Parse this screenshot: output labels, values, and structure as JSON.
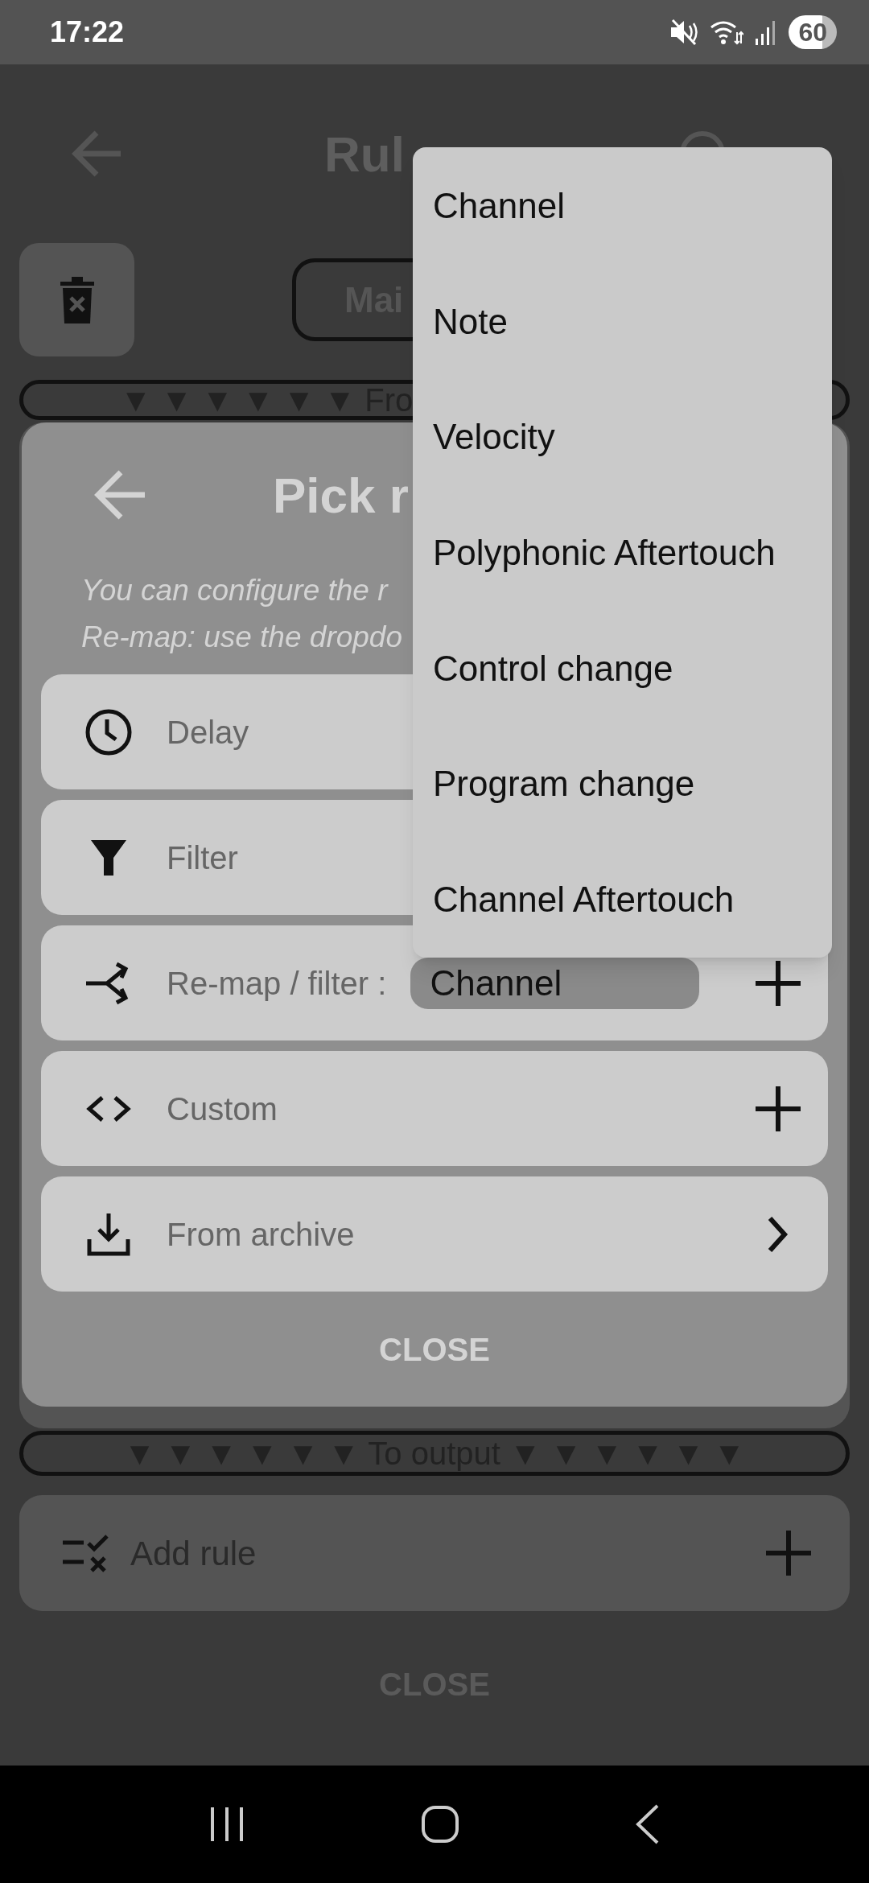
{
  "status_bar": {
    "time": "17:22",
    "battery": "60"
  },
  "page": {
    "title": "Rul",
    "tab_button": "Mai",
    "input_bar": "▼ ▼ ▼ ▼ ▼ ▼ Fro",
    "output_bar": "▼ ▼ ▼ ▼ ▼ ▼ To output ▼ ▼ ▼ ▼ ▼ ▼",
    "add_rule": "Add rule",
    "close": "CLOSE"
  },
  "dialog": {
    "title": "Pick r",
    "subtitle": [
      "You can configure the r",
      "Re-map: use the dropdo"
    ],
    "options": [
      {
        "kind": "delay",
        "label": "Delay"
      },
      {
        "kind": "filter",
        "label": "Filter"
      },
      {
        "kind": "remap",
        "label": "Re-map / filter :",
        "value": "Channel",
        "add": true
      },
      {
        "kind": "custom",
        "label": "Custom",
        "add": true
      },
      {
        "kind": "archive",
        "label": "From archive",
        "open": true
      }
    ],
    "close": "CLOSE"
  },
  "menu": {
    "items": [
      "Channel",
      "Note",
      "Velocity",
      "Polyphonic Aftertouch",
      "Control change",
      "Program change",
      "Channel Aftertouch"
    ]
  }
}
